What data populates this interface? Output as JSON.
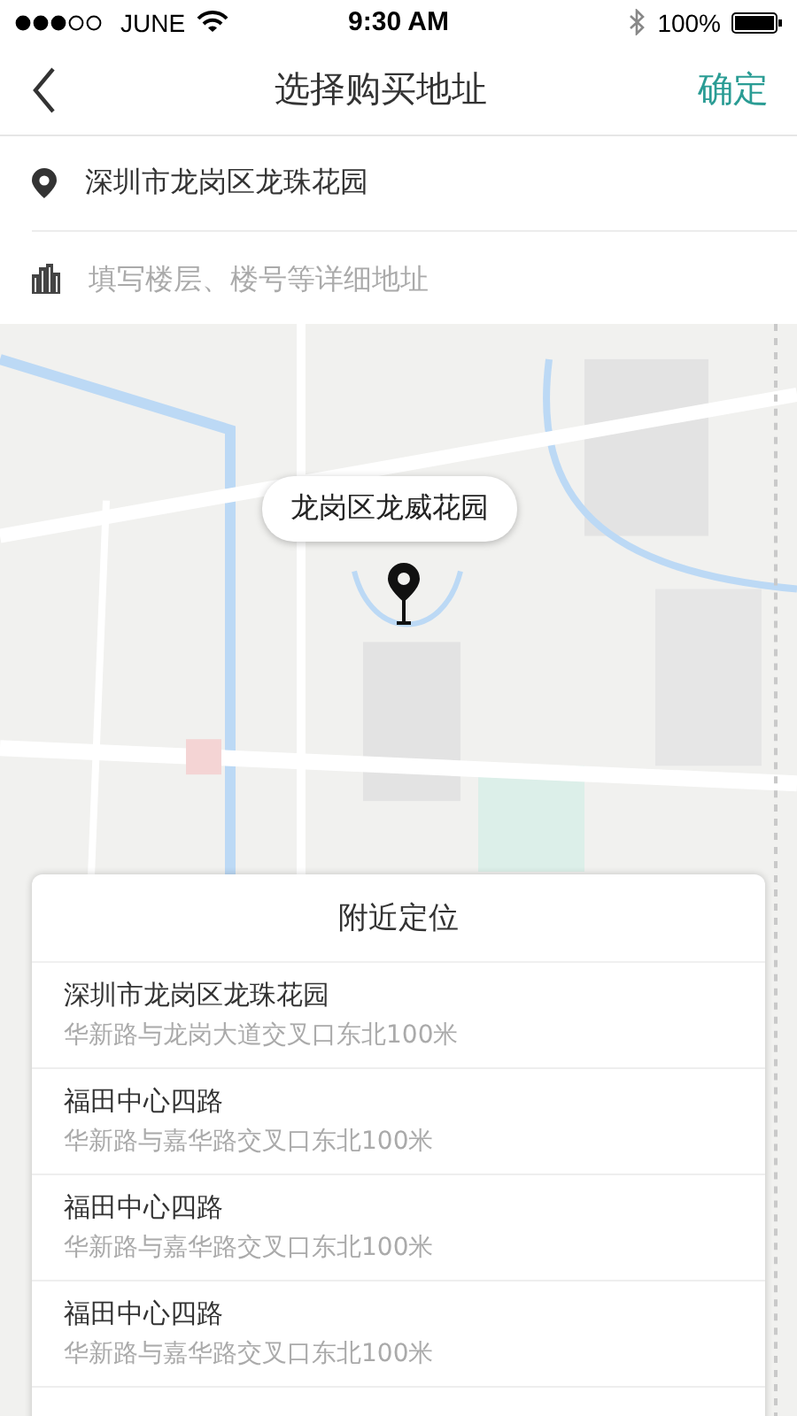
{
  "status_bar": {
    "carrier": "JUNE",
    "time": "9:30 AM",
    "battery": "100%"
  },
  "nav": {
    "title": "选择购买地址",
    "action": "确定"
  },
  "address": {
    "value": "深圳市龙岗区龙珠花园"
  },
  "detail_field": {
    "placeholder": "填写楼层、楼号等详细地址"
  },
  "map": {
    "callout": "龙岗区龙威花园"
  },
  "nearby": {
    "title": "附近定位",
    "items": [
      {
        "name": "深圳市龙岗区龙珠花园",
        "desc": "华新路与龙岗大道交叉口东北100米"
      },
      {
        "name": "福田中心四路",
        "desc": "华新路与嘉华路交叉口东北100米"
      },
      {
        "name": "福田中心四路",
        "desc": "华新路与嘉华路交叉口东北100米"
      },
      {
        "name": "福田中心四路",
        "desc": "华新路与嘉华路交叉口东北100米"
      }
    ]
  }
}
